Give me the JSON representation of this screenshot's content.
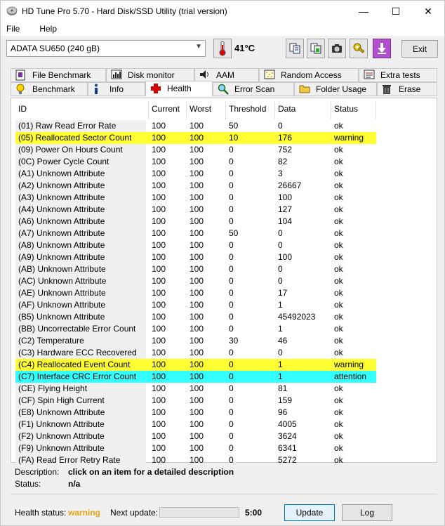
{
  "window": {
    "title": "HD Tune Pro 5.70 - Hard Disk/SSD Utility (trial version)",
    "minimize": "—",
    "maximize": "☐",
    "close": "✕"
  },
  "menu": {
    "file": "File",
    "help": "Help"
  },
  "toolbar": {
    "drive": "ADATA SU650 (240 gB)",
    "temperature": "41°C",
    "exit_label": "Exit"
  },
  "tabs_top": [
    {
      "label": "File Benchmark",
      "icon": "file-benchmark-icon"
    },
    {
      "label": "Disk monitor",
      "icon": "disk-monitor-icon"
    },
    {
      "label": "AAM",
      "icon": "speaker-icon"
    },
    {
      "label": "Random Access",
      "icon": "random-access-icon"
    },
    {
      "label": "Extra tests",
      "icon": "extra-tests-icon"
    }
  ],
  "tabs_bottom": [
    {
      "label": "Benchmark",
      "icon": "lightbulb-icon"
    },
    {
      "label": "Info",
      "icon": "info-icon"
    },
    {
      "label": "Health",
      "icon": "health-cross-icon"
    },
    {
      "label": "Error Scan",
      "icon": "magnifier-icon"
    },
    {
      "label": "Folder Usage",
      "icon": "folder-icon"
    },
    {
      "label": "Erase",
      "icon": "trash-icon"
    }
  ],
  "columns": [
    "ID",
    "Current",
    "Worst",
    "Threshold",
    "Data",
    "Status"
  ],
  "rows": [
    {
      "id": "(01) Raw Read Error Rate",
      "cur": "100",
      "worst": "100",
      "th": "50",
      "data": "0",
      "status": "ok",
      "hl": ""
    },
    {
      "id": "(05) Reallocated Sector Count",
      "cur": "100",
      "worst": "100",
      "th": "10",
      "data": "176",
      "status": "warning",
      "hl": "yellow"
    },
    {
      "id": "(09) Power On Hours Count",
      "cur": "100",
      "worst": "100",
      "th": "0",
      "data": "752",
      "status": "ok",
      "hl": ""
    },
    {
      "id": "(0C) Power Cycle Count",
      "cur": "100",
      "worst": "100",
      "th": "0",
      "data": "82",
      "status": "ok",
      "hl": ""
    },
    {
      "id": "(A1) Unknown Attribute",
      "cur": "100",
      "worst": "100",
      "th": "0",
      "data": "3",
      "status": "ok",
      "hl": ""
    },
    {
      "id": "(A2) Unknown Attribute",
      "cur": "100",
      "worst": "100",
      "th": "0",
      "data": "26667",
      "status": "ok",
      "hl": ""
    },
    {
      "id": "(A3) Unknown Attribute",
      "cur": "100",
      "worst": "100",
      "th": "0",
      "data": "100",
      "status": "ok",
      "hl": ""
    },
    {
      "id": "(A4) Unknown Attribute",
      "cur": "100",
      "worst": "100",
      "th": "0",
      "data": "127",
      "status": "ok",
      "hl": ""
    },
    {
      "id": "(A6) Unknown Attribute",
      "cur": "100",
      "worst": "100",
      "th": "0",
      "data": "104",
      "status": "ok",
      "hl": ""
    },
    {
      "id": "(A7) Unknown Attribute",
      "cur": "100",
      "worst": "100",
      "th": "50",
      "data": "0",
      "status": "ok",
      "hl": ""
    },
    {
      "id": "(A8) Unknown Attribute",
      "cur": "100",
      "worst": "100",
      "th": "0",
      "data": "0",
      "status": "ok",
      "hl": ""
    },
    {
      "id": "(A9) Unknown Attribute",
      "cur": "100",
      "worst": "100",
      "th": "0",
      "data": "100",
      "status": "ok",
      "hl": ""
    },
    {
      "id": "(AB) Unknown Attribute",
      "cur": "100",
      "worst": "100",
      "th": "0",
      "data": "0",
      "status": "ok",
      "hl": ""
    },
    {
      "id": "(AC) Unknown Attribute",
      "cur": "100",
      "worst": "100",
      "th": "0",
      "data": "0",
      "status": "ok",
      "hl": ""
    },
    {
      "id": "(AE) Unknown Attribute",
      "cur": "100",
      "worst": "100",
      "th": "0",
      "data": "17",
      "status": "ok",
      "hl": ""
    },
    {
      "id": "(AF) Unknown Attribute",
      "cur": "100",
      "worst": "100",
      "th": "0",
      "data": "1",
      "status": "ok",
      "hl": ""
    },
    {
      "id": "(B5) Unknown Attribute",
      "cur": "100",
      "worst": "100",
      "th": "0",
      "data": "45492023",
      "status": "ok",
      "hl": ""
    },
    {
      "id": "(BB) Uncorrectable Error Count",
      "cur": "100",
      "worst": "100",
      "th": "0",
      "data": "1",
      "status": "ok",
      "hl": ""
    },
    {
      "id": "(C2) Temperature",
      "cur": "100",
      "worst": "100",
      "th": "30",
      "data": "46",
      "status": "ok",
      "hl": ""
    },
    {
      "id": "(C3) Hardware ECC Recovered",
      "cur": "100",
      "worst": "100",
      "th": "0",
      "data": "0",
      "status": "ok",
      "hl": ""
    },
    {
      "id": "(C4) Reallocated Event Count",
      "cur": "100",
      "worst": "100",
      "th": "0",
      "data": "1",
      "status": "warning",
      "hl": "yellow"
    },
    {
      "id": "(C7) Interface CRC Error Count",
      "cur": "100",
      "worst": "100",
      "th": "0",
      "data": "1",
      "status": "attention",
      "hl": "cyan"
    },
    {
      "id": "(CE) Flying Height",
      "cur": "100",
      "worst": "100",
      "th": "0",
      "data": "81",
      "status": "ok",
      "hl": ""
    },
    {
      "id": "(CF) Spin High Current",
      "cur": "100",
      "worst": "100",
      "th": "0",
      "data": "159",
      "status": "ok",
      "hl": ""
    },
    {
      "id": "(E8) Unknown Attribute",
      "cur": "100",
      "worst": "100",
      "th": "0",
      "data": "96",
      "status": "ok",
      "hl": ""
    },
    {
      "id": "(F1) Unknown Attribute",
      "cur": "100",
      "worst": "100",
      "th": "0",
      "data": "4005",
      "status": "ok",
      "hl": ""
    },
    {
      "id": "(F2) Unknown Attribute",
      "cur": "100",
      "worst": "100",
      "th": "0",
      "data": "3624",
      "status": "ok",
      "hl": ""
    },
    {
      "id": "(F9) Unknown Attribute",
      "cur": "100",
      "worst": "100",
      "th": "0",
      "data": "6341",
      "status": "ok",
      "hl": ""
    },
    {
      "id": "(FA) Read Error Retry Rate",
      "cur": "100",
      "worst": "100",
      "th": "0",
      "data": "5272",
      "status": "ok",
      "hl": ""
    }
  ],
  "description": {
    "label": "Description:",
    "value": "click on an item for a detailed description",
    "status_label": "Status:",
    "status_value": "n/a"
  },
  "footer": {
    "health_label": "Health status:",
    "health_value": "warning",
    "health_color": "#e8a317",
    "next_update_label": "Next update:",
    "progress_fraction": 0.0,
    "time": "5:00",
    "update_label": "Update",
    "log_label": "Log"
  }
}
